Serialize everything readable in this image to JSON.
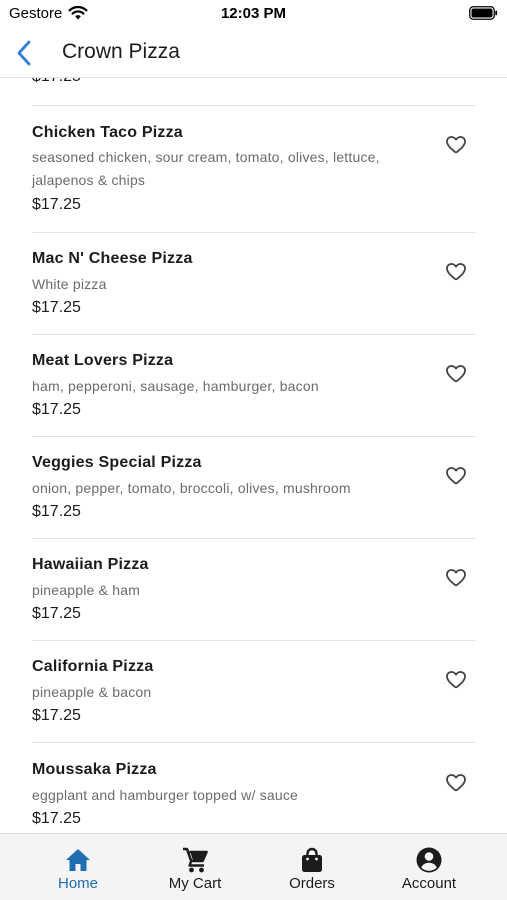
{
  "status_bar": {
    "carrier": "Gestore",
    "time": "12:03 PM"
  },
  "nav": {
    "title": "Crown Pizza",
    "back_icon": "chevron-left-icon"
  },
  "colors": {
    "accent": "#1f6fb0",
    "back_arrow": "#2f7ed8",
    "text_primary": "#1c1c1e",
    "text_secondary": "#6b6b70",
    "separator": "#e3e3e6",
    "tab_bar_bg": "#f4f4f6"
  },
  "menu": {
    "partial_price": "$17.25",
    "items": [
      {
        "name": "Chicken Taco Pizza",
        "description": "seasoned chicken, sour cream, tomato, olives, lettuce, jalapenos & chips",
        "price": "$17.25",
        "favorite_icon": "heart-outline-icon"
      },
      {
        "name": "Mac N' Cheese Pizza",
        "description": "White pizza",
        "price": "$17.25",
        "favorite_icon": "heart-outline-icon"
      },
      {
        "name": "Meat Lovers Pizza",
        "description": "ham, pepperoni, sausage, hamburger, bacon",
        "price": "$17.25",
        "favorite_icon": "heart-outline-icon"
      },
      {
        "name": "Veggies Special Pizza",
        "description": "onion, pepper, tomato, broccoli, olives, mushroom",
        "price": "$17.25",
        "favorite_icon": "heart-outline-icon"
      },
      {
        "name": "Hawaiian Pizza",
        "description": "pineapple & ham",
        "price": "$17.25",
        "favorite_icon": "heart-outline-icon"
      },
      {
        "name": "California Pizza",
        "description": "pineapple & bacon",
        "price": "$17.25",
        "favorite_icon": "heart-outline-icon"
      },
      {
        "name": "Moussaka Pizza",
        "description": "eggplant and hamburger topped w/ sauce",
        "price": "$17.25",
        "favorite_icon": "heart-outline-icon"
      }
    ]
  },
  "tabs": [
    {
      "label": "Home",
      "icon": "home-icon",
      "active": true
    },
    {
      "label": "My Cart",
      "icon": "cart-icon",
      "active": false
    },
    {
      "label": "Orders",
      "icon": "shopping-bag-icon",
      "active": false
    },
    {
      "label": "Account",
      "icon": "account-circle-icon",
      "active": false
    }
  ]
}
